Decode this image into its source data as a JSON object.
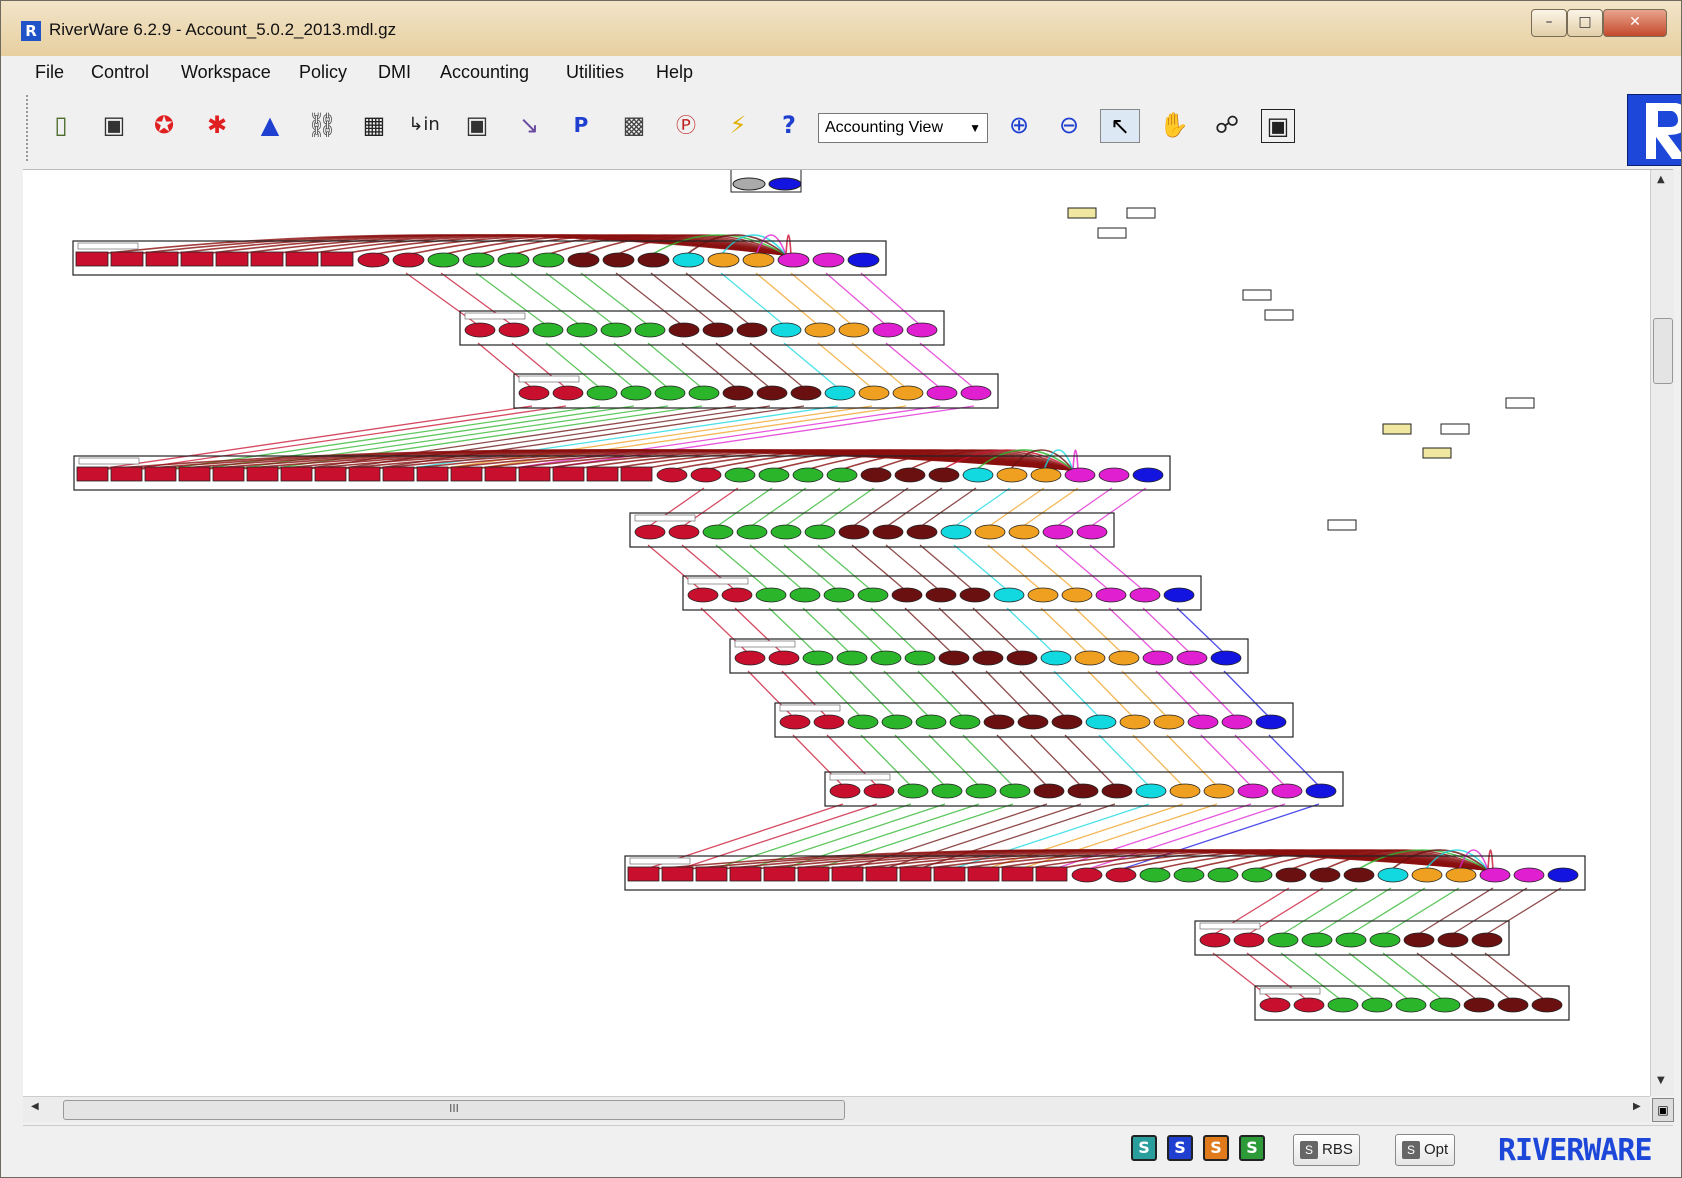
{
  "window": {
    "title": "RiverWare 6.2.9 - Account_5.0.2_2013.mdl.gz",
    "app_icon": "R",
    "controls": [
      "minimize-icon",
      "maximize-icon",
      "close-icon"
    ]
  },
  "menubar": {
    "items": [
      "File",
      "Control",
      "Workspace",
      "Policy",
      "DMI",
      "Accounting",
      "Utilities",
      "Help"
    ]
  },
  "toolbar": {
    "icons": [
      "open-icon",
      "save-icon",
      "run-icon",
      "run-multiple-icon",
      "triangle-icon",
      "link-icon",
      "grid-icon",
      "input-icon",
      "camera-icon",
      "plot-icon",
      "policy-icon",
      "database-icon",
      "dmi-icon",
      "lightning-icon",
      "help-icon"
    ],
    "view_select": {
      "value": "Accounting View"
    },
    "view_tools": [
      "zoom-in-icon",
      "zoom-out-icon",
      "pointer-icon",
      "hand-icon",
      "telescope-icon",
      "camera-view-icon"
    ]
  },
  "canvas": {
    "scroll_marker": "III"
  },
  "statusbar": {
    "s_buttons": [
      {
        "label": "S",
        "color": "#2a9d9d"
      },
      {
        "label": "S",
        "color": "#1e3fd0"
      },
      {
        "label": "S",
        "color": "#e07a1a"
      },
      {
        "label": "S",
        "color": "#2d9a3a"
      }
    ],
    "rbs_label": "RBS",
    "opt_label": "Opt",
    "brand_text": "RIVERWARE"
  }
}
